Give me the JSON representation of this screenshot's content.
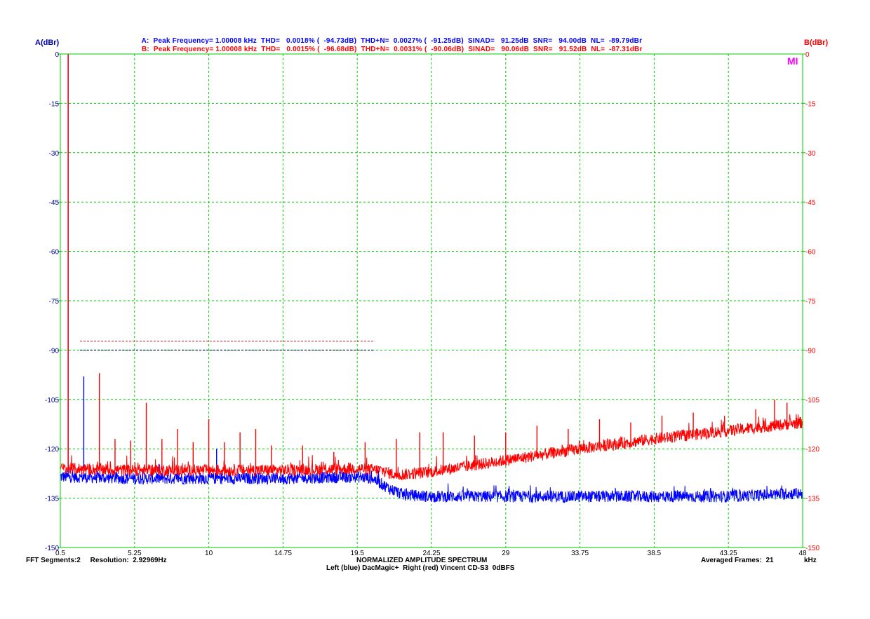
{
  "header": {
    "line_a": {
      "color": "#0000ff",
      "text": "A:  Peak Frequency= 1.00008 kHz  THD=   0.0018% (  -94.73dB)  THD+N=  0.0027% (  -91.25dB)  SINAD=   91.25dB  SNR=   94.00dB  NL=  -89.79dBr"
    },
    "line_b": {
      "color": "#ff0000",
      "text": "B:  Peak Frequency= 1.00008 kHz  THD=   0.0015% (  -96.68dB)  THD+N=  0.0031% (  -90.06dB)  SINAD=   90.06dB  SNR=   91.52dB  NL=  -87.31dBr"
    }
  },
  "left_axis_title": "A(dBr)",
  "right_axis_title": "B(dBr)",
  "logo_text": "MI",
  "footer": {
    "left": "FFT Segments:2     Resolution:  2.92969Hz",
    "title": "NORMALIZED AMPLITUDE SPECTRUM",
    "subtitle": "Left (blue) DacMagic+  Right (red) Vincent CD-S3  0dBFS",
    "right": "Averaged Frames:  21",
    "unit": "kHz"
  },
  "colors": {
    "grid": "#00cc00",
    "axis_text_left": "#0000aa",
    "axis_text_right": "#ff0000",
    "x_text": "#000000",
    "series_a": "#0000ff",
    "series_b": "#ff0000"
  },
  "chart_data": {
    "type": "line",
    "title": "NORMALIZED AMPLITUDE SPECTRUM",
    "xlabel": "kHz",
    "ylabel": "A(dBr)",
    "y2label": "B(dBr)",
    "xlim": [
      0.5,
      48
    ],
    "ylim": [
      -150,
      0
    ],
    "x_ticks": [
      "0.5",
      "5.25",
      "10",
      "14.75",
      "19.5",
      "24.25",
      "29",
      "33.75",
      "38.5",
      "43.25",
      "48"
    ],
    "y_ticks": [
      "0",
      "-15",
      "-30",
      "-45",
      "-60",
      "-75",
      "-90",
      "-105",
      "-120",
      "-135",
      "-150"
    ],
    "grid": true,
    "series": [
      {
        "name": "Left (blue) DacMagic+",
        "color": "#0000ff",
        "noise_floor": [
          [
            0.5,
            -128.5
          ],
          [
            5,
            -129
          ],
          [
            10,
            -129
          ],
          [
            15,
            -129
          ],
          [
            19.5,
            -128.5
          ],
          [
            20.5,
            -129
          ],
          [
            21.5,
            -132
          ],
          [
            22.5,
            -134
          ],
          [
            24.25,
            -134.5
          ],
          [
            29,
            -134.5
          ],
          [
            33.75,
            -134.5
          ],
          [
            38.5,
            -134.5
          ],
          [
            43.25,
            -134.5
          ],
          [
            48,
            -133.5
          ]
        ],
        "peaks": [
          [
            1.0,
            0
          ],
          [
            2.0,
            -98
          ],
          [
            10.5,
            -120
          ],
          [
            13.0,
            -125
          ]
        ],
        "noise_level_line": -90
      },
      {
        "name": "Right (red) Vincent CD-S3",
        "color": "#ff0000",
        "noise_floor": [
          [
            0.5,
            -126
          ],
          [
            5,
            -126.5
          ],
          [
            10,
            -126.5
          ],
          [
            15,
            -126.5
          ],
          [
            19.5,
            -126
          ],
          [
            21,
            -126.5
          ],
          [
            22,
            -128
          ],
          [
            24.25,
            -127
          ],
          [
            29,
            -123.5
          ],
          [
            33.75,
            -120
          ],
          [
            38.5,
            -117
          ],
          [
            43.25,
            -114.5
          ],
          [
            48,
            -112
          ]
        ],
        "peaks": [
          [
            1.0,
            0
          ],
          [
            3.0,
            -97
          ],
          [
            4.0,
            -117
          ],
          [
            5.0,
            -117.5
          ],
          [
            6.0,
            -106
          ],
          [
            7.0,
            -117
          ],
          [
            8.0,
            -114
          ],
          [
            9.0,
            -118
          ],
          [
            10.0,
            -111
          ],
          [
            11.0,
            -118
          ],
          [
            12.0,
            -115
          ],
          [
            13.0,
            -114
          ],
          [
            14.0,
            -119
          ],
          [
            16.0,
            -119
          ],
          [
            18.0,
            -121
          ],
          [
            20.0,
            -118
          ],
          [
            22.0,
            -117
          ],
          [
            23.5,
            -115
          ],
          [
            25.0,
            -115
          ],
          [
            27.0,
            -116
          ],
          [
            29.0,
            -115
          ],
          [
            31.0,
            -113
          ],
          [
            33.0,
            -114
          ],
          [
            35.0,
            -111
          ],
          [
            37.0,
            -112
          ],
          [
            39.0,
            -110
          ],
          [
            41.0,
            -109
          ],
          [
            43.0,
            -110
          ],
          [
            45.0,
            -108
          ],
          [
            46.2,
            -105
          ],
          [
            47.0,
            -106
          ]
        ],
        "noise_level_line": -87.3
      }
    ],
    "noise_level_span": [
      0.5,
      20.0
    ]
  }
}
